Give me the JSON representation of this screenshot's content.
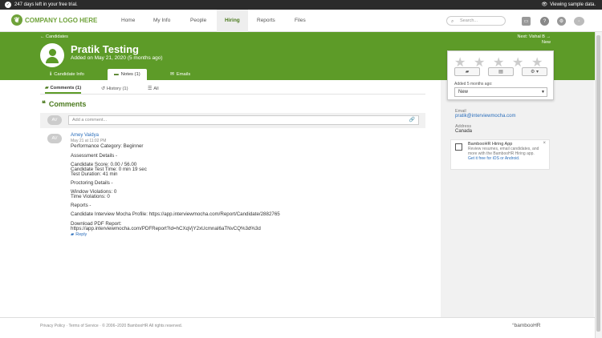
{
  "topbar": {
    "trial_text": "247 days left in your free trial.",
    "sample_text": "Viewing sample data."
  },
  "nav": {
    "logo_text": "COMPANY LOGO HERE",
    "items": [
      {
        "label": "Home"
      },
      {
        "label": "My Info"
      },
      {
        "label": "People"
      },
      {
        "label": "Hiring"
      },
      {
        "label": "Reports"
      },
      {
        "label": "Files"
      }
    ],
    "search_placeholder": "Search..."
  },
  "header": {
    "breadcrumb": "← Candidates",
    "name": "Pratik Testing",
    "added": "Added on May 21, 2020 (5 months ago)",
    "next_label": "Next: Vishal B →",
    "next_sub": "New",
    "tabs": [
      {
        "label": "Candidate Info"
      },
      {
        "label": "Notes (1)"
      },
      {
        "label": "Emails"
      }
    ]
  },
  "rating_card": {
    "rating": 0,
    "max_rating": 5,
    "added_label": "Added 5 months ago:",
    "status": "New"
  },
  "sidebar": {
    "email_label": "Email",
    "email": "pratik@interviewmocha.com",
    "address_label": "Address",
    "address": "Canada",
    "app_title": "BambooHR Hiring App",
    "app_text": "Review resumes, email candidates, and more with the BambooHR Hiring app.",
    "app_get": "Get it free for iOS or Android."
  },
  "subtabs": [
    {
      "label": "Comments (1)"
    },
    {
      "label": "History (1)"
    },
    {
      "label": "All"
    }
  ],
  "comments": {
    "title": "Comments",
    "placeholder": "Add a comment...",
    "avatar_initials": "AV",
    "author": "Amey Vaidya",
    "date": "May 21 at 11:02 PM",
    "lines": [
      "Performance Category: Beginner",
      "Assessment Details -",
      "Candidate Score: 0.00 / 56.00",
      "Candidate Test Time: 0 min 19 sec",
      "Test Duration: 41 min",
      "Proctoring Details -",
      "Window Violations: 0",
      "Time Violations: 0",
      "Reports -",
      "Candidate Interview Mocha Profile: https://app.interviewmocha.com/Report/Candidate/2882765",
      "Download PDF Report:",
      "https://app.interviewmocha.com/PDFReport?id=hCXqVjY2xUcmnaI6aTNvCQ%3d%3d"
    ],
    "reply_label": "Reply"
  },
  "footer": {
    "privacy": "Privacy Policy",
    "terms": "Terms of Service",
    "copyright": "© 2006–2020 BambooHR All rights reserved.",
    "brand": "°bambooHR"
  }
}
